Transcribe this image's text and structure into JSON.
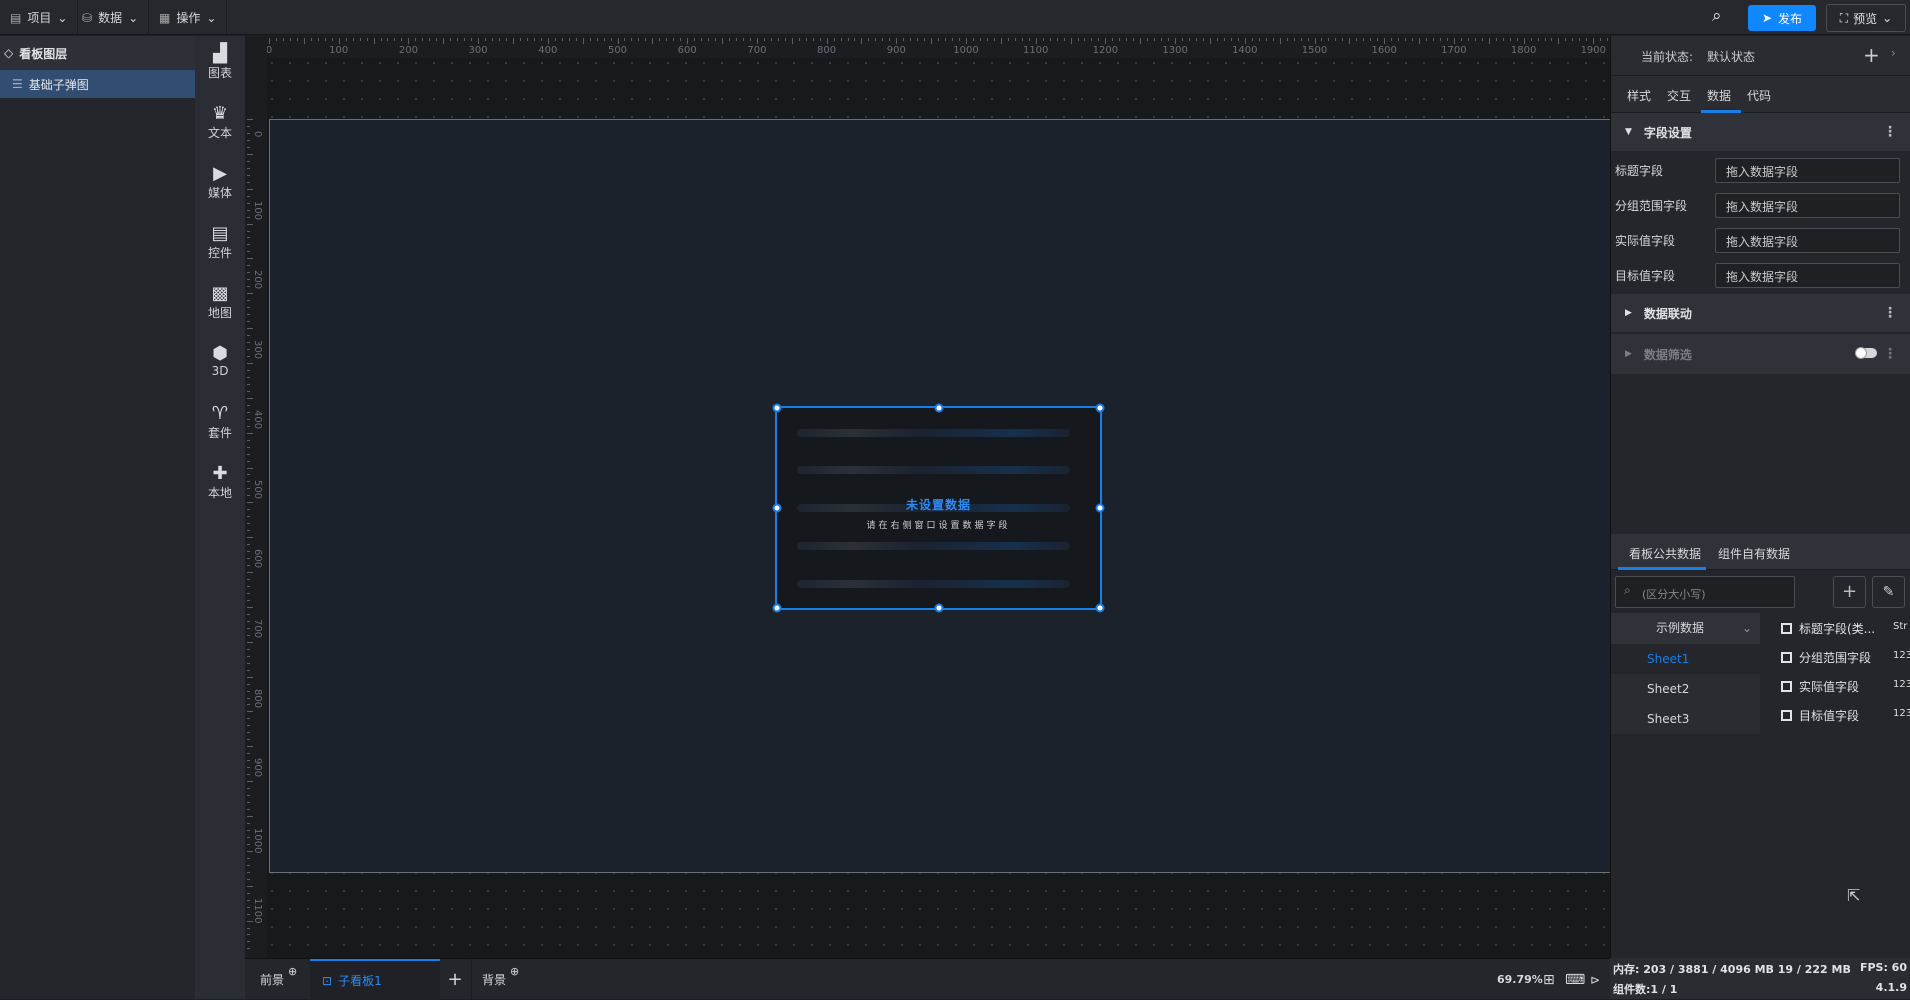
{
  "topbar": {
    "menus": [
      {
        "icon": "file-icon",
        "label": "项目"
      },
      {
        "icon": "database-icon",
        "label": "数据"
      },
      {
        "icon": "grid-icon",
        "label": "操作"
      }
    ],
    "publish": "发布",
    "preview": "预览"
  },
  "layers": {
    "title": "看板图层",
    "items": [
      "基础子弹图"
    ]
  },
  "toolbar": [
    {
      "label": "图表",
      "icon": "chart-icon"
    },
    {
      "label": "文本",
      "icon": "text-icon"
    },
    {
      "label": "媒体",
      "icon": "media-icon"
    },
    {
      "label": "控件",
      "icon": "control-icon"
    },
    {
      "label": "地图",
      "icon": "map-icon"
    },
    {
      "label": "3D",
      "icon": "cube-icon"
    },
    {
      "label": "套件",
      "icon": "shirt-icon"
    },
    {
      "label": "本地",
      "icon": "puzzle-icon"
    }
  ],
  "ruler": {
    "top": [
      "0",
      "100",
      "200",
      "300",
      "400",
      "500",
      "600",
      "700",
      "800",
      "900",
      "1000",
      "1100",
      "1200",
      "1300",
      "1400",
      "1500",
      "1600",
      "1700",
      "1800",
      "1900"
    ],
    "left": [
      "0",
      "100",
      "200",
      "300",
      "400",
      "500",
      "600",
      "700",
      "800",
      "900",
      "1000",
      "1100"
    ]
  },
  "widget": {
    "title": "未设置数据",
    "subtitle": "请在右侧窗口设置数据字段"
  },
  "bottom": {
    "foreground": "前景",
    "tab": "子看板1",
    "background": "背景",
    "zoom": "69.79%"
  },
  "panel": {
    "state_label": "当前状态:",
    "state_value": "默认状态",
    "tabs": [
      "样式",
      "交互",
      "数据",
      "代码"
    ],
    "active_tab": 2,
    "field_section": "字段设置",
    "fields": [
      {
        "label": "标题字段",
        "placeholder": "拖入数据字段"
      },
      {
        "label": "分组范围字段",
        "placeholder": "拖入数据字段"
      },
      {
        "label": "实际值字段",
        "placeholder": "拖入数据字段"
      },
      {
        "label": "目标值字段",
        "placeholder": "拖入数据字段"
      }
    ],
    "linkage": "数据联动",
    "filter": "数据筛选",
    "filter_enabled": false,
    "data_tabs": [
      "看板公共数据",
      "组件自有数据"
    ],
    "search_placeholder": "(区分大小写)",
    "dataset": "示例数据",
    "sheets": [
      "Sheet1",
      "Sheet2",
      "Sheet3"
    ],
    "active_sheet": 0,
    "columns": [
      {
        "name": "标题字段(类...",
        "type": "Str"
      },
      {
        "name": "分组范围字段",
        "type": "123"
      },
      {
        "name": "实际值字段",
        "type": "123"
      },
      {
        "name": "目标值字段",
        "type": "123"
      }
    ]
  },
  "status": {
    "memory": "内存: 203 / 3881 / 4096 MB  19 / 222 MB",
    "fps": "FPS: 60",
    "components": "组件数:1 / 1",
    "version": "4.1.9"
  },
  "colors": {
    "accent": "#1a7ee8",
    "publish": "#0f87ff"
  }
}
